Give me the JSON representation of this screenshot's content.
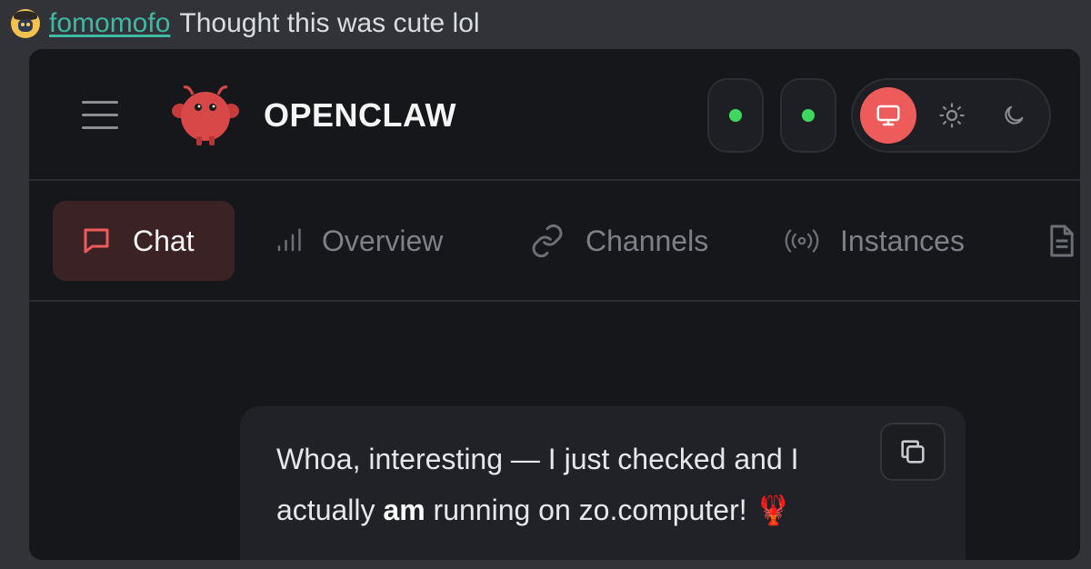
{
  "message": {
    "username": "fomomofo",
    "text": "Thought this was cute lol"
  },
  "app": {
    "brand": "OPENCLAW",
    "status_indicators": [
      {
        "color": "#3fd760"
      },
      {
        "color": "#3fd760"
      }
    ],
    "theme_options": [
      {
        "icon": "monitor-icon",
        "active": true
      },
      {
        "icon": "sun-icon",
        "active": false
      },
      {
        "icon": "moon-icon",
        "active": false
      }
    ],
    "tabs": [
      {
        "label": "Chat",
        "icon": "chat-bubble-icon",
        "active": true
      },
      {
        "label": "Overview",
        "icon": "bar-chart-icon",
        "active": false
      },
      {
        "label": "Channels",
        "icon": "link-icon",
        "active": false
      },
      {
        "label": "Instances",
        "icon": "broadcast-icon",
        "active": false
      },
      {
        "label": "",
        "icon": "document-icon",
        "active": false
      }
    ]
  },
  "chat": {
    "bubble": {
      "line1": "Whoa, interesting — I just checked and I",
      "line2_prefix": "actually ",
      "line2_bold": "am",
      "line2_suffix": " running on zo.computer!",
      "emoji": "🦞"
    }
  },
  "colors": {
    "accent": "#ee5b5b",
    "username": "#3fb9a1",
    "status_online": "#3fd760"
  }
}
